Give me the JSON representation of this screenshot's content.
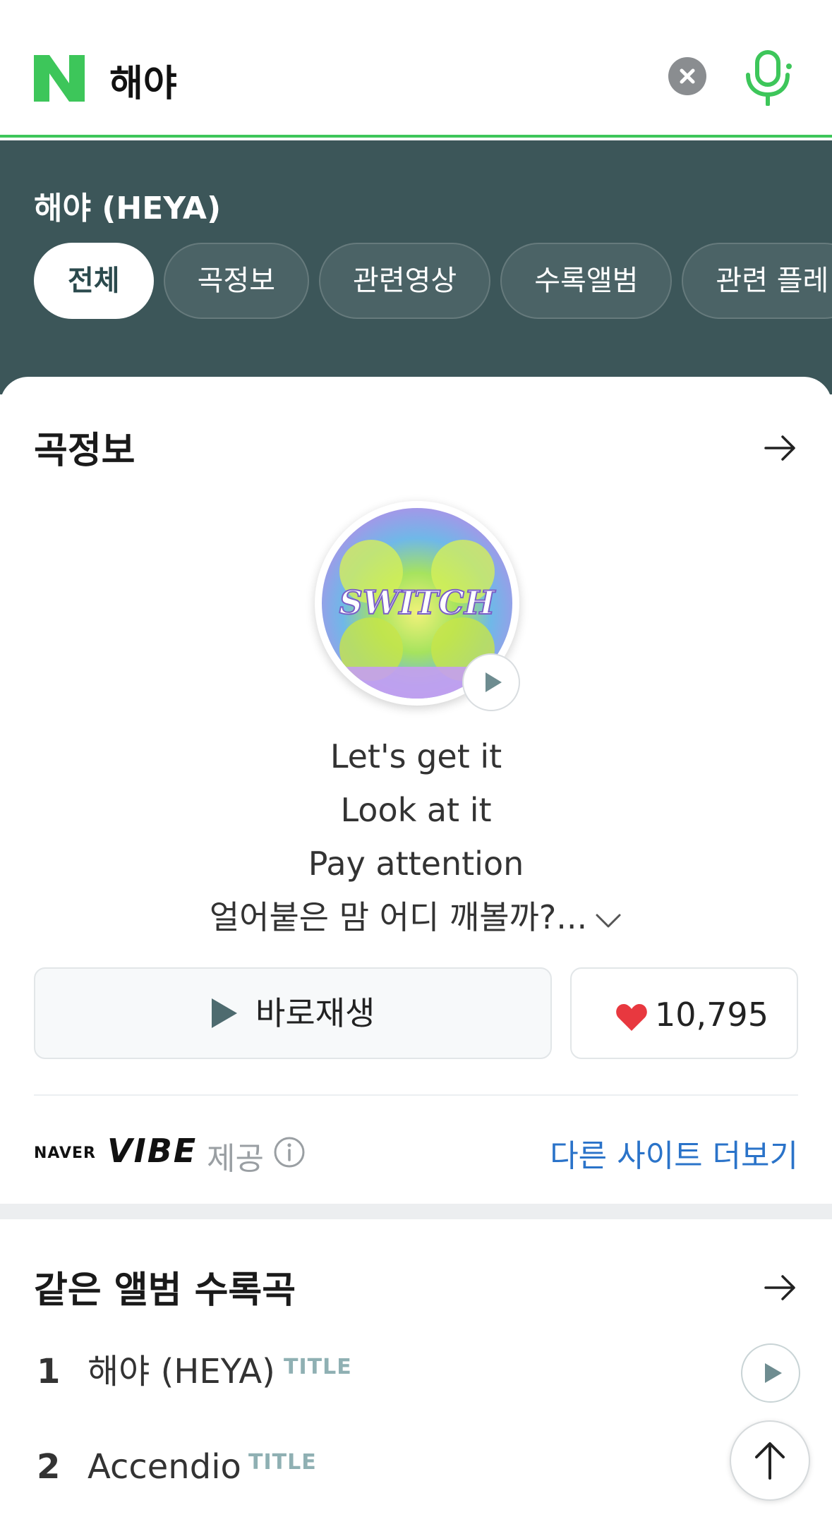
{
  "search": {
    "logo_letter": "N",
    "query": "해야",
    "accent_color": "#3dc65a"
  },
  "header": {
    "song_title": "해야 (HEYA)",
    "tabs": [
      {
        "label": "전체",
        "active": true
      },
      {
        "label": "곡정보",
        "active": false
      },
      {
        "label": "관련영상",
        "active": false
      },
      {
        "label": "수록앨범",
        "active": false
      },
      {
        "label": "관련 플레",
        "active": false
      }
    ],
    "bg_color": "#3c5659"
  },
  "song_info": {
    "section_title": "곡정보",
    "album_art_text": "SWITCH",
    "lyrics": [
      "Let's get it",
      "Look at it",
      "Pay attention",
      "얼어붙은 맘 어디 깨볼까?..."
    ],
    "play_button_label": "바로재생",
    "like_count": "10,795",
    "provider": {
      "naver": "NAVER",
      "vibe": "VIBE",
      "label": "제공"
    },
    "more_sites_label": "다른 사이트 더보기"
  },
  "same_album": {
    "section_title": "같은 앨범 수록곡",
    "tracks": [
      {
        "num": "1",
        "name": "해야 (HEYA)",
        "badge": "TITLE"
      },
      {
        "num": "2",
        "name": "Accendio",
        "badge": "TITLE"
      }
    ]
  },
  "icons": {
    "clear": "close-icon",
    "mic": "microphone-icon",
    "arrow": "arrow-right-icon",
    "play": "play-icon",
    "heart": "heart-icon",
    "info": "info-icon",
    "chevron": "chevron-down-icon",
    "scroll_top": "arrow-up-icon"
  }
}
